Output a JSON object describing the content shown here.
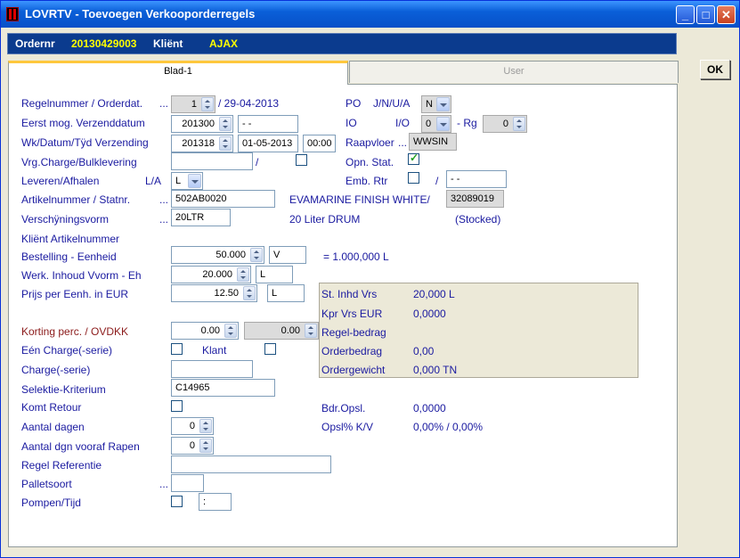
{
  "window": {
    "title": "LOVRTV - Toevoegen Verkooporderregels"
  },
  "infobar": {
    "ordernr_label": "Ordernr",
    "ordernr_value": "20130429003",
    "klient_label": "Kliënt",
    "klient_value": "AJAX"
  },
  "tabs": [
    {
      "label": "Blad-1",
      "active": true
    },
    {
      "label": "User",
      "active": false
    }
  ],
  "ok_button": "OK",
  "form": {
    "regelnummer_label": "Regelnummer / Orderdat.",
    "regelnummer_dots": "...",
    "regelnummer_value": "1",
    "orderdat": "/ 29-04-2013",
    "eerst_label": "Eerst mog. Verzenddatum",
    "eerst_value": "201300",
    "eerst_date": "- -",
    "wk_label": "Wk/Datum/Tÿd Verzending",
    "wk_value": "201318",
    "wk_date": "01-05-2013",
    "wk_time": "00:00",
    "vrg_label": "Vrg.Charge/Bulklevering",
    "vrg_value": "",
    "vrg_slash": "/",
    "vrg_checked": false,
    "leveren_label": "Leveren/Afhalen",
    "leveren_la": "L/A",
    "leveren_value": "L",
    "artikel_label": "Artikelnummer / Statnr.",
    "artikel_dots": "...",
    "artikel_value": "502AB0020",
    "artikel_desc": "EVAMARINE FINISH WHITE/",
    "statnr": "32089019",
    "verschijning_label": "Verschÿningsvorm",
    "verschijning_dots": "...",
    "verschijning_value": "20LTR",
    "verschijning_desc": "20 Liter DRUM",
    "stocked": "(Stocked)",
    "klient_art_label": "Kliënt Artikelnummer",
    "bestelling_label": "Bestelling - Eenheid",
    "bestelling_value": "50.000",
    "bestelling_unit": "V",
    "bestelling_total": "= 1.000,000 L",
    "werk_label": "Werk. Inhoud Vvorm - Eh",
    "werk_value": "20.000",
    "werk_unit": "L",
    "prijs_label": "Prijs per Eenh. in EUR",
    "prijs_value": "12.50",
    "prijs_unit": "L",
    "korting_label": "Korting perc. / OVDKK",
    "korting_value": "0.00",
    "ovdkk_value": "0.00",
    "een_charge_label": "Eén Charge(-serie)",
    "een_charge_checked": false,
    "klant_label": "Klant",
    "klant_checked": false,
    "charge_label": "Charge(-serie)",
    "charge_value": "",
    "selektie_label": "Selektie-Kriterium",
    "selektie_value": "C14965",
    "komt_label": "Komt Retour",
    "komt_checked": false,
    "aantal_dagen_label": "Aantal dagen",
    "aantal_dagen_value": "0",
    "aantal_dgn_label": "Aantal dgn vooraf Rapen",
    "aantal_dgn_value": "0",
    "regel_ref_label": "Regel Referentie",
    "regel_ref_value": "",
    "palletsoort_label": "Palletsoort",
    "palletsoort_dots": "...",
    "palletsoort_value": "",
    "pompen_label": "Pompen/Tijd",
    "pompen_checked": false,
    "pompen_time": ":",
    "po_label": "PO",
    "po_jnua": "J/N/U/A",
    "po_value": "N",
    "io_label": "IO",
    "io_io": "I/O",
    "io_value": "0",
    "rg_label": "- Rg",
    "rg_value": "0",
    "raap_label": "Raapvloer",
    "raap_dots": "...",
    "raap_value": "WWSIN",
    "opn_label": "Opn. Stat.",
    "opn_checked": true,
    "emb_label": "Emb. Rtr",
    "emb_checked": false,
    "emb_slash": "/",
    "emb_date": "- -"
  },
  "summary": {
    "st_label": "St. Inhd Vrs",
    "st_value": "20,000 L",
    "kpr_label": "Kpr Vrs  EUR",
    "kpr_value": "0,0000",
    "regel_label": "Regel-bedrag",
    "regel_value": "",
    "order_label": "Orderbedrag",
    "order_value": "0,00",
    "gewicht_label": "Ordergewicht",
    "gewicht_value": "0,000 TN"
  },
  "extra": {
    "bdr_label": "Bdr.Opsl.",
    "bdr_value": "0,0000",
    "opsl_label": "Opsl% K/V",
    "opsl_value": "0,00% / 0,00%"
  },
  "colors": {
    "title_bar": "#0a5fd8",
    "info_bar": "#0b3b8e",
    "info_value": "#ffff00",
    "label": "#1a1aa0",
    "korting_label": "#8b1a1a"
  }
}
